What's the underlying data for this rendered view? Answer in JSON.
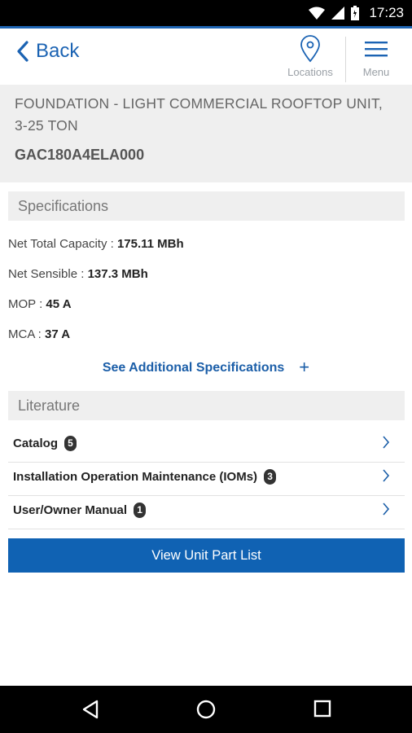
{
  "status_bar": {
    "time": "17:23"
  },
  "header": {
    "back_label": "Back",
    "locations_label": "Locations",
    "menu_label": "Menu"
  },
  "product": {
    "name": "FOUNDATION - LIGHT COMMERCIAL ROOFTOP UNIT, 3-25 TON",
    "model": "GAC180A4ELA000"
  },
  "specifications": {
    "title": "Specifications",
    "items": [
      {
        "label": "Net Total Capacity : ",
        "value": "175.11 MBh"
      },
      {
        "label": "Net Sensible : ",
        "value": "137.3 MBh"
      },
      {
        "label": "MOP : ",
        "value": "45 A"
      },
      {
        "label": "MCA : ",
        "value": "37 A"
      }
    ],
    "see_more_label": "See Additional Specifications",
    "see_more_icon": "+"
  },
  "literature": {
    "title": "Literature",
    "items": [
      {
        "label": "Catalog",
        "count": "5"
      },
      {
        "label": "Installation Operation Maintenance (IOMs)",
        "count": "3"
      },
      {
        "label": "User/Owner Manual",
        "count": "1"
      }
    ]
  },
  "actions": {
    "view_parts_label": "View Unit Part List"
  },
  "colors": {
    "accent": "#1062b3",
    "link": "#1b5ea8",
    "section_bg": "#efefef"
  }
}
